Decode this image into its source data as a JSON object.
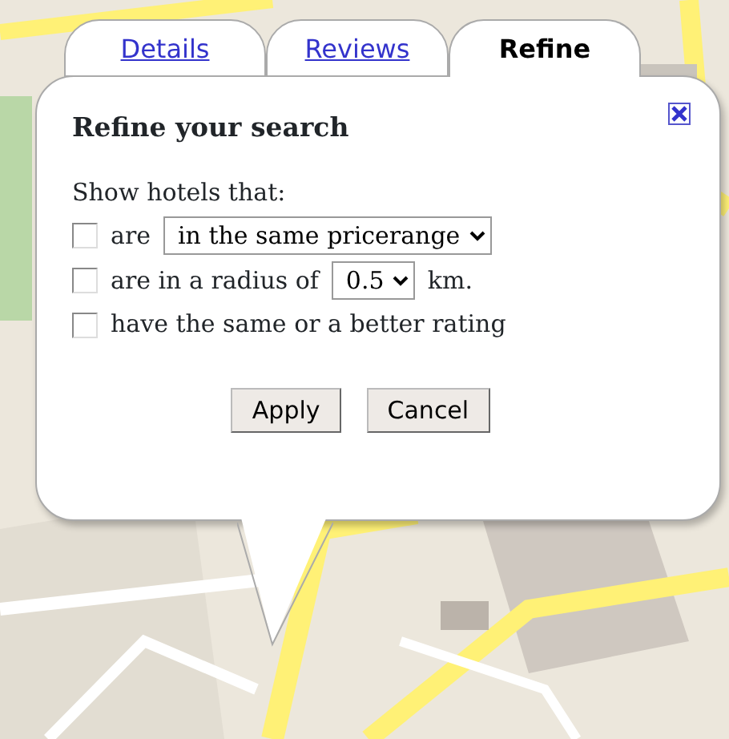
{
  "tabs": [
    {
      "label": "Details",
      "selected": false
    },
    {
      "label": "Reviews",
      "selected": false
    },
    {
      "label": "Refine",
      "selected": true
    }
  ],
  "title": "Refine your search",
  "intro": "Show hotels that:",
  "filters": [
    {
      "kind": "select",
      "label": "are",
      "checked": false,
      "value": "in the same pricerange"
    },
    {
      "kind": "select",
      "label": "are in a radius of",
      "checked": false,
      "value": "0.5",
      "suffix": "km."
    },
    {
      "kind": "plain",
      "label": "have the same or a better rating",
      "checked": false
    }
  ],
  "buttons": [
    "Apply",
    "Cancel"
  ]
}
